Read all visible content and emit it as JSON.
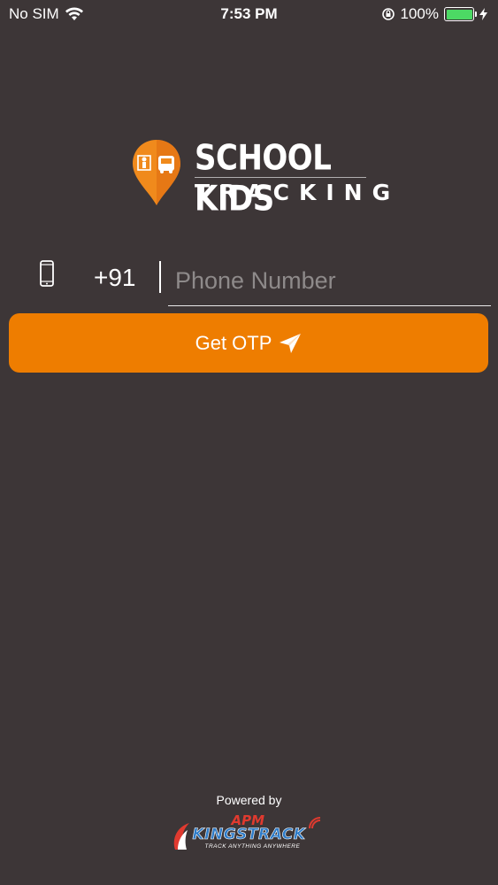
{
  "status_bar": {
    "carrier": "No SIM",
    "time": "7:53 PM",
    "battery_percent": "100%",
    "icons": [
      "wifi-icon",
      "orientation-lock-icon",
      "battery-icon",
      "charging-icon"
    ]
  },
  "logo": {
    "line1": "SCHOOL KIDS",
    "line2": "TRACKING",
    "pin_color": "#f08a1c"
  },
  "login": {
    "phone_icon": "mobile-phone-icon",
    "country_code": "+91",
    "phone_placeholder": "Phone Number",
    "phone_value": "",
    "otp_button_label": "Get OTP",
    "otp_button_icon": "send-icon",
    "accent_color": "#ee7d00"
  },
  "footer": {
    "powered_by": "Powered by",
    "brand_prefix": "APM",
    "brand_name": "KINGSTRACK",
    "brand_tagline": "TRACK ANYTHING ANYWHERE"
  }
}
